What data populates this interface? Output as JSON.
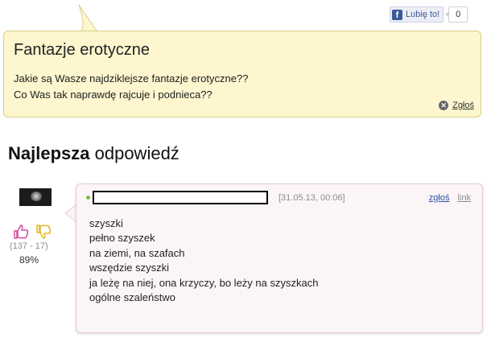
{
  "like_bar": {
    "button_label": "Lubię to!",
    "fb_logo": "f",
    "count": "0"
  },
  "question": {
    "title": "Fantazje erotyczne",
    "line1": "Jakie są Wasze najdziklejsze fantazje erotyczne??",
    "line2": "Co Was tak naprawdę rajcuje i podnieca??",
    "report_label": "Zgłoś",
    "report_icon": "report-x-icon"
  },
  "best_answer": {
    "heading_bold": "Najlepsza",
    "heading_rest": " odpowiedź"
  },
  "voting": {
    "votes": "(137 - 17)",
    "percent": "89%"
  },
  "answer": {
    "date": "[31.05.13, 00:06]",
    "report_label": "zgłoś",
    "link_label": "link",
    "lines": [
      "szyszki",
      "pełno szyszek",
      "na ziemi, na szafach",
      "wszędzie szyszki",
      "ja leżę na niej, ona krzyczy, bo leży na szyszkach",
      "ogólne szaleństwo"
    ]
  },
  "colors": {
    "question_bg": "#fdf6cf",
    "answer_bg": "#fcf5f8",
    "thumb_up": "#d24aa0",
    "thumb_down": "#e6b422",
    "online": "#7ac142",
    "link": "#2a55a6"
  }
}
